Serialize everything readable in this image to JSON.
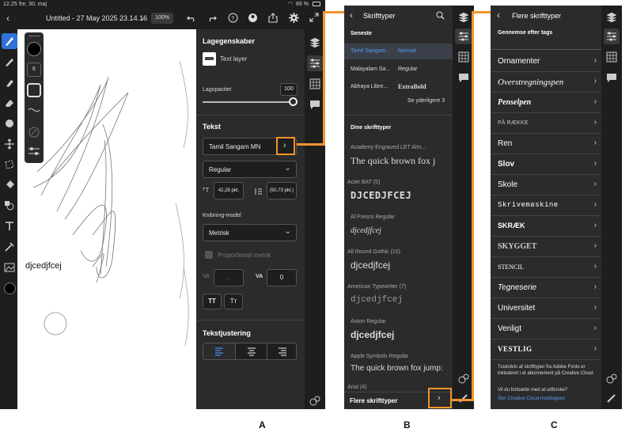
{
  "captions": {
    "a": "A",
    "b": "B",
    "c": "C"
  },
  "panelA": {
    "status": {
      "time": "12.25",
      "date": "fre. 30. maj",
      "battery": "89 %"
    },
    "title": "Untitled - 27 May 2025 23.14.16",
    "zoom": "100%",
    "brush_size": "6",
    "canvas_text": "djcedjfcej",
    "layer_props": {
      "title": "Lagegenskaber",
      "layer_name": "Text layer",
      "opacity_label": "Lagopacitet",
      "opacity_value": "100"
    },
    "text": {
      "title": "Tekst",
      "font": "Tamil Sangam MN",
      "style": "Regular",
      "size": "42,28 pkt.",
      "leading": "(50,73 pkt.)",
      "kerning_label": "Knibning-model",
      "kerning_value": "Metrisk",
      "proportional": "Proportional metrik",
      "va_left": "VA",
      "tracking_value": "...",
      "va_right": "VA",
      "tracking_num": "0",
      "tt1": "TT",
      "tt2": "Tт"
    },
    "alignment": {
      "title": "Tekstjustering"
    }
  },
  "panelB": {
    "title": "Skrifttyper",
    "recent_header": "Seneste",
    "recent": [
      {
        "name": "Tamil Sangam...",
        "style": "Normal"
      },
      {
        "name": "Malayalam Sa...",
        "style": "Regular"
      },
      {
        "name": "Abhaya Libre...",
        "style": "ExtraBold"
      }
    ],
    "see_more": "Se yderligere 3",
    "your_fonts_header": "Dine skrifttyper",
    "fonts": [
      {
        "name": "Academy Engraved LET Alm...",
        "sample": "The quick brown fox j"
      },
      {
        "name": "Acier BAT (5)",
        "sample": "DJCEDJFCEJ"
      },
      {
        "name": "Al Fresco Regular",
        "sample": "djcedjfcej"
      },
      {
        "name": "All Round Gothic (10)",
        "sample": "djcedjfcej"
      },
      {
        "name": "American Typewriter (7)",
        "sample": "djcedjfcej"
      },
      {
        "name": "Anton Regular",
        "sample": "djcedjfcej"
      },
      {
        "name": "Apple Symbols Regular",
        "sample": "The quick brown fox jump:"
      },
      {
        "name": "Arial (4)",
        "sample": ""
      }
    ],
    "more_fonts": "Flere skrifttyper"
  },
  "panelC": {
    "title": "Flere skrifttyper",
    "subheader": "Gennemse efter tags",
    "categories": [
      "Ornamenter",
      "Overstregningspen",
      "Penselpen",
      "På række",
      "Ren",
      "Slov",
      "Skole",
      "Skrivemaskine",
      "Skræk",
      "Skygget",
      "Stencil",
      "Tegneserie",
      "Universitet",
      "Venligt",
      "Vestlig"
    ],
    "footer1": "Tusindvis af skrifttyper fra Adobe Fonts er inkluderet i et abonnement på Creative Cloud.",
    "footer2": "Vil du fortsætte med at udforske?",
    "footer_link": "Åbn Creative Cloud-mobilappen"
  },
  "colors": {
    "accent": "#f0952d",
    "selection": "#3a3f4a",
    "active_tool": "#2f73d9"
  }
}
